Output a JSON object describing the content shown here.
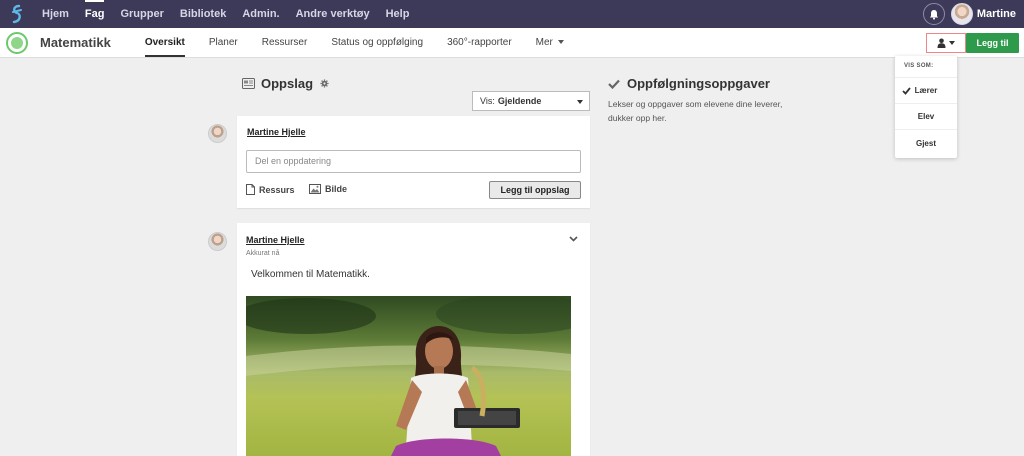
{
  "topbar": {
    "nav": [
      "Hjem",
      "Fag",
      "Grupper",
      "Bibliotek",
      "Admin.",
      "Andre verktøy",
      "Help"
    ],
    "active": "Fag",
    "user_name": "Martine"
  },
  "subnav": {
    "course_title": "Matematikk",
    "tabs": [
      "Oversikt",
      "Planer",
      "Ressurser",
      "Status og oppfølging",
      "360°-rapporter",
      "Mer"
    ],
    "active_tab": "Oversikt",
    "add_button": "Legg til"
  },
  "role_menu": {
    "header": "VIS SOM:",
    "options": [
      "Lærer",
      "Elev",
      "Gjest"
    ],
    "selected": "Lærer"
  },
  "posts": {
    "title": "Oppslag",
    "filter_label": "Vis:",
    "filter_value": "Gjeldende",
    "compose": {
      "author": "Martine Hjelle",
      "placeholder": "Del en oppdatering",
      "resource_label": "Ressurs",
      "image_label": "Bilde",
      "submit_label": "Legg til oppslag"
    },
    "items": [
      {
        "author": "Martine Hjelle",
        "time": "Akkurat nå",
        "text": "Velkommen til Matematikk."
      }
    ]
  },
  "followup": {
    "title": "Oppfølgningsoppgaver",
    "description": "Lekser og oppgaver som elevene dine leverer, dukker opp her."
  },
  "colors": {
    "topbar": "#3d3a59",
    "accent_green": "#2e9a4c"
  }
}
